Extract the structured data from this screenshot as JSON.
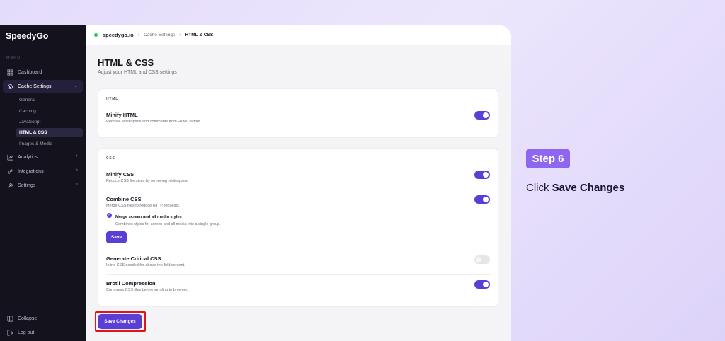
{
  "app": {
    "logo": "SpeedyGo",
    "menu_label": "MENU",
    "nav": {
      "dashboard": "Dashboard",
      "cache_settings": "Cache Settings",
      "analytics": "Analytics",
      "integrations": "Integrations",
      "settings": "Settings"
    },
    "sub_nav": [
      "General",
      "Caching",
      "JavaScript",
      "HTML & CSS",
      "Images & Media"
    ],
    "bottom_nav": {
      "collapse": "Collapse",
      "logout": "Log out"
    }
  },
  "topbar": {
    "site": "speedygo.io",
    "breadcrumb": [
      "Cache Settings",
      "HTML & CSS"
    ]
  },
  "page": {
    "title": "HTML & CSS",
    "subtitle": "Adjust your HTML and CSS settings"
  },
  "html_card": {
    "label": "HTML",
    "minify_html": {
      "title": "Minify HTML",
      "desc": "Remove whitespace and comments from HTML output.",
      "enabled": true
    }
  },
  "css_card": {
    "label": "CSS",
    "minify_css": {
      "title": "Minify CSS",
      "desc": "Reduce CSS file sizes by removing whitespace.",
      "enabled": true
    },
    "combine_css": {
      "title": "Combine CSS",
      "desc": "Merge CSS files to reduce HTTP requests.",
      "enabled": true,
      "option": {
        "title": "Merge screen and all media styles",
        "desc": "Combines styles for screen and all media into a single group.",
        "checked": true
      },
      "save_label": "Save"
    },
    "critical_css": {
      "title": "Generate Critical CSS",
      "desc": "Inline CSS needed for above-the-fold content.",
      "enabled": false
    },
    "brotli": {
      "title": "Brotli Compression",
      "desc": "Compress CSS files before sending to browser.",
      "enabled": true
    }
  },
  "actions": {
    "save_changes": "Save Changes"
  },
  "tutorial": {
    "step": "Step 6",
    "instruction_prefix": "Click",
    "instruction_target": "Save Changes"
  },
  "colors": {
    "accent": "#5b3fd4",
    "sidebar_bg": "#14131d",
    "step_badge": "#8f66f0",
    "highlight": "#e0151b",
    "status_online": "#23c55e"
  }
}
